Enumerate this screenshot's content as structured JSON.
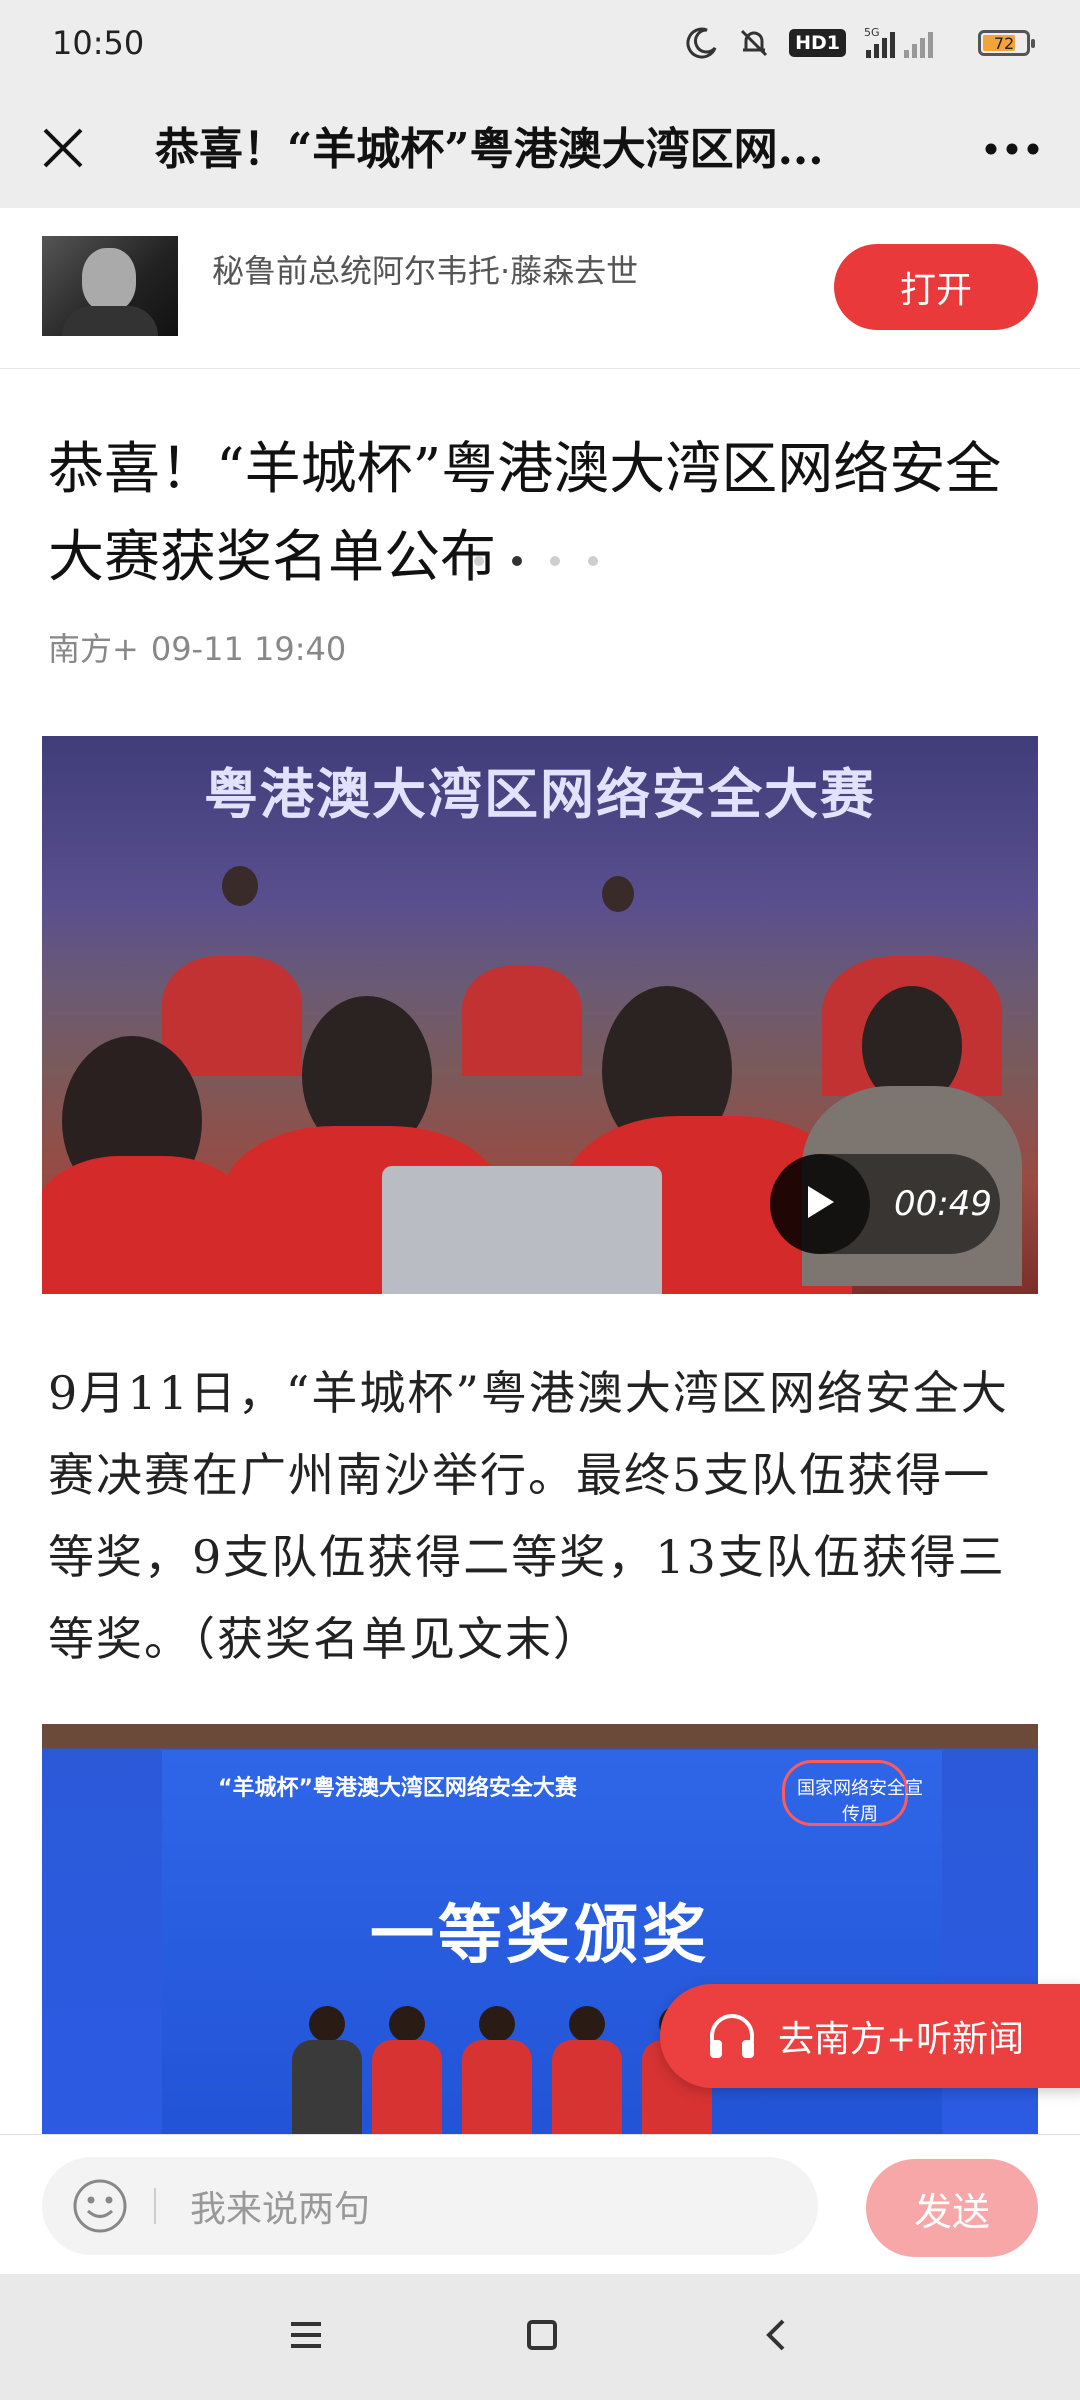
{
  "status_bar": {
    "time": "10:50",
    "network_badge": "HD1",
    "network_type": "5G",
    "battery_level": "72",
    "icons": [
      "moon-icon",
      "bell-muted-icon",
      "signal-icon",
      "battery-icon"
    ]
  },
  "title_bar": {
    "title": "恭喜！“羊城杯”粤港澳大湾区网...",
    "close_icon": "close-icon",
    "more_icon": "more-icon"
  },
  "banner": {
    "headline": "秘鲁前总统阿尔韦托·藤森去世",
    "open_label": "打开",
    "dots_active_index": 1,
    "dots_count": 4
  },
  "article": {
    "title": "恭喜！“羊城杯”粤港澳大湾区网络安全大赛获奖名单公布",
    "source": "南方+",
    "datetime": "09-11 19:40",
    "video": {
      "banner_text": "粤港澳大湾区网络安全大赛",
      "duration": "00:49"
    },
    "paragraph": "9月11日，“羊城杯”粤港澳大湾区网络安全大赛决赛在广州南沙举行。最终5支队伍获得一等奖，9支队伍获得二等奖，13支队伍获得三等奖。（获奖名单见文末）",
    "photo2": {
      "small_title": "“羊城杯”粤港澳大湾区网络安全大赛",
      "logo_text": "国家网络安全宣传周",
      "main_text": "一等奖颁奖"
    }
  },
  "listen_button": {
    "label": "去南方+听新闻"
  },
  "comment_bar": {
    "placeholder": "我来说两句",
    "send_label": "发送"
  },
  "colors": {
    "accent_red": "#e9393b",
    "send_disabled": "#f7a7a7",
    "bar_gray": "#ededed"
  }
}
